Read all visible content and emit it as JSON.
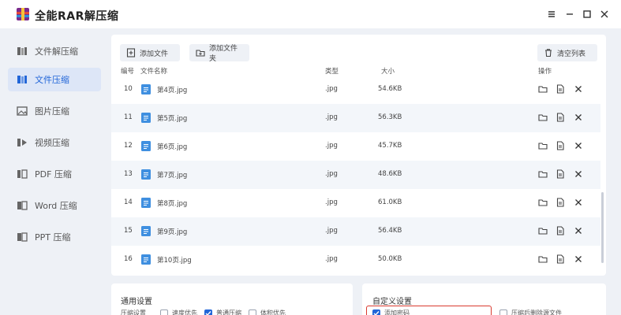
{
  "app": {
    "title": "全能RAR解压缩"
  },
  "sidebar": {
    "items": [
      {
        "label": "文件解压缩",
        "icon": "archive-icon",
        "active": false
      },
      {
        "label": "文件压缩",
        "icon": "compress-icon",
        "active": true
      },
      {
        "label": "图片压缩",
        "icon": "image-icon",
        "active": false
      },
      {
        "label": "视频压缩",
        "icon": "video-icon",
        "active": false
      },
      {
        "label": "PDF 压缩",
        "icon": "pdf-icon",
        "active": false
      },
      {
        "label": "Word 压缩",
        "icon": "word-icon",
        "active": false
      },
      {
        "label": "PPT 压缩",
        "icon": "ppt-icon",
        "active": false
      }
    ]
  },
  "toolbar": {
    "add_file": "添加文件",
    "add_folder": "添加文件夹",
    "clear_list": "清空列表"
  },
  "table": {
    "headers": {
      "index": "编号",
      "name": "文件名称",
      "type": "类型",
      "size": "大小",
      "ops": "操作"
    },
    "rows": [
      {
        "index": "10",
        "name": "第4页.jpg",
        "type": ".jpg",
        "size": "54.6KB"
      },
      {
        "index": "11",
        "name": "第5页.jpg",
        "type": ".jpg",
        "size": "56.3KB"
      },
      {
        "index": "12",
        "name": "第6页.jpg",
        "type": ".jpg",
        "size": "45.7KB"
      },
      {
        "index": "13",
        "name": "第7页.jpg",
        "type": ".jpg",
        "size": "48.6KB"
      },
      {
        "index": "14",
        "name": "第8页.jpg",
        "type": ".jpg",
        "size": "61.0KB"
      },
      {
        "index": "15",
        "name": "第9页.jpg",
        "type": ".jpg",
        "size": "56.4KB"
      },
      {
        "index": "16",
        "name": "第10页.jpg",
        "type": ".jpg",
        "size": "50.0KB"
      }
    ]
  },
  "general_settings": {
    "title": "通用设置",
    "mode_label": "压缩设置",
    "options": [
      {
        "label": "速度优先",
        "checked": false
      },
      {
        "label": "普通压缩",
        "checked": true
      },
      {
        "label": "体积优先",
        "checked": false
      }
    ]
  },
  "custom_settings": {
    "title": "自定义设置",
    "options": [
      {
        "label": "添加密码",
        "checked": true
      },
      {
        "label": "压缩后删除源文件",
        "checked": false
      }
    ]
  },
  "colors": {
    "accent": "#2266d8",
    "highlight": "#d93a2f",
    "background": "#eef1f6"
  }
}
